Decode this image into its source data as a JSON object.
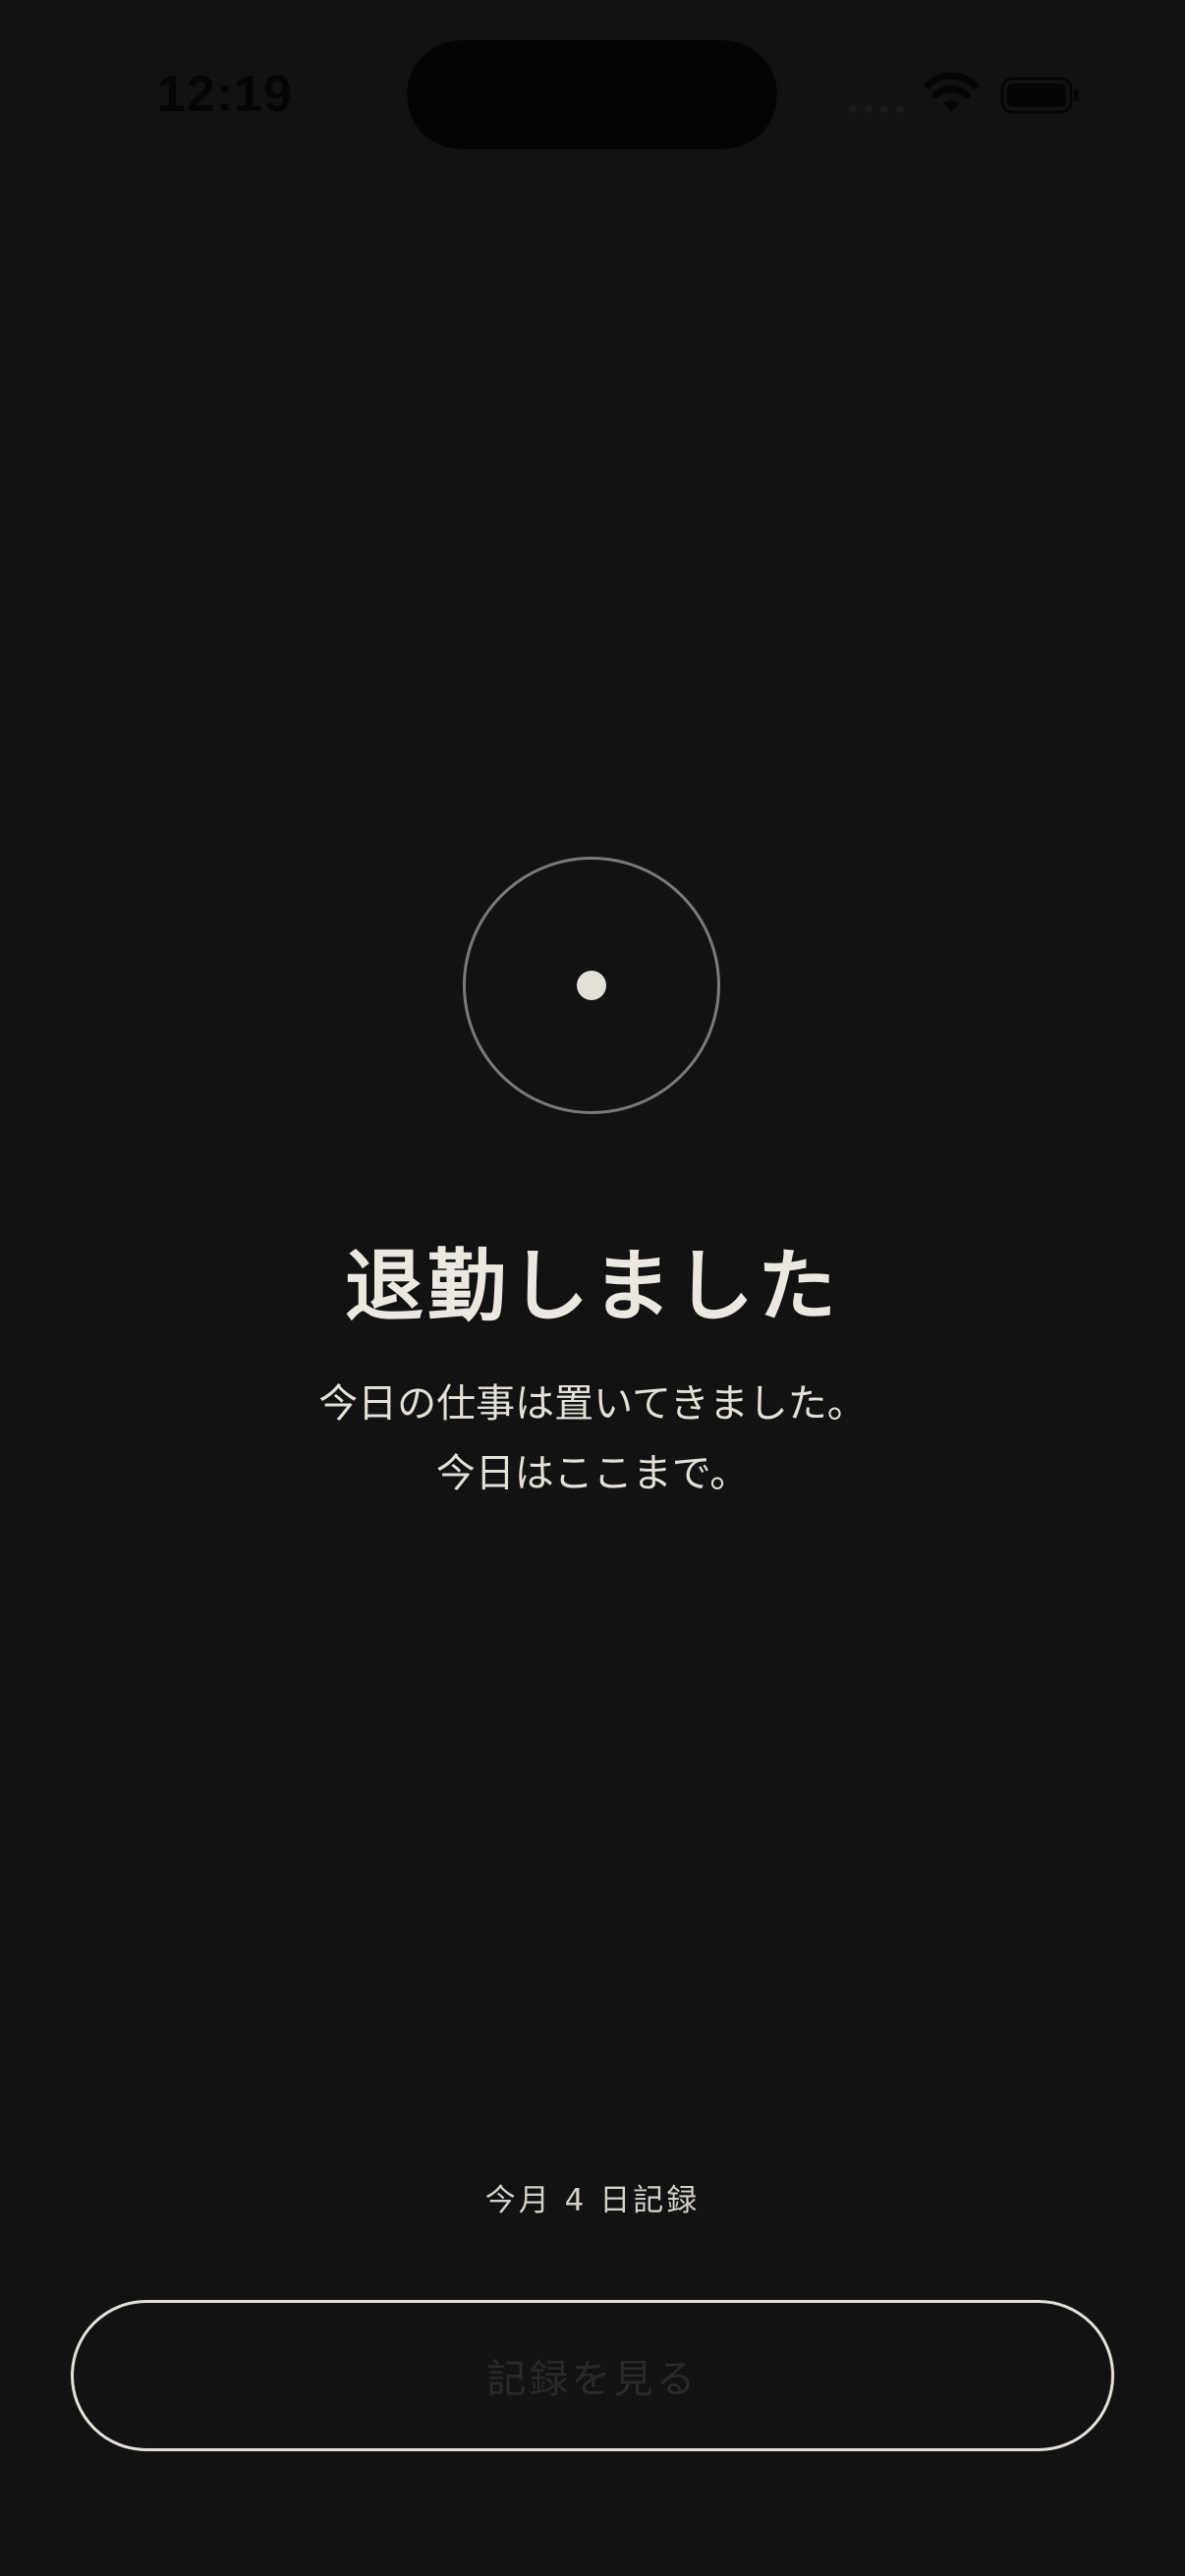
{
  "status_bar": {
    "time": "12:19",
    "icons": [
      "cellular-signal-icon",
      "wifi-icon",
      "battery-icon"
    ]
  },
  "main": {
    "icon": "record-ring-icon",
    "title": "退勤しました",
    "message_line1": "今日の仕事は置いてきました。",
    "message_line2": "今日はここまで。",
    "month_count": "今月 4 日記録"
  },
  "actions": {
    "view_records_label": "記録を見る"
  },
  "colors": {
    "background": "#121212",
    "text_primary": "#ebe8e1",
    "ring": "#7a7a7a",
    "button_border": "#e4e1da",
    "button_text": "#2a2a2a"
  }
}
